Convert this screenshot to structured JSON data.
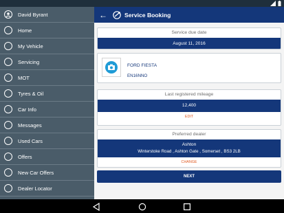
{
  "drawer": {
    "user_name": "David Byrant",
    "items": [
      {
        "label": "Home",
        "icon": "home-icon"
      },
      {
        "label": "My Vehicle",
        "icon": "car-icon"
      },
      {
        "label": "Servicing",
        "icon": "wrench-icon"
      },
      {
        "label": "MOT",
        "icon": "mot-icon"
      },
      {
        "label": "Tyres & Oil",
        "icon": "tyre-icon"
      },
      {
        "label": "Car Info",
        "icon": "info-icon"
      },
      {
        "label": "Messages",
        "icon": "envelope-icon"
      },
      {
        "label": "Used Cars",
        "icon": "car-icon"
      },
      {
        "label": "Offers",
        "icon": "tag-icon"
      },
      {
        "label": "New Car Offers",
        "icon": "car-icon"
      },
      {
        "label": "Dealer Locator",
        "icon": "location-pin-icon"
      }
    ]
  },
  "appbar": {
    "title": "Service Booking"
  },
  "service_due": {
    "heading": "Service due date",
    "value": "August 11, 2016"
  },
  "vehicle": {
    "model": "FORD FIESTA",
    "registration": "EN16NNO"
  },
  "mileage": {
    "heading": "Last registered mileage",
    "value": "12,400",
    "action": "EDIT"
  },
  "dealer": {
    "heading": "Preferred dealer",
    "name": "Ashton",
    "address": "Winterstoke Road , Ashton Gate , Somerset , BS3 2LB",
    "action": "CHANGE"
  },
  "next_label": "NEXT",
  "colors": {
    "primary": "#14377a",
    "drawer": "#4a5c69",
    "accent": "#e05a22"
  }
}
